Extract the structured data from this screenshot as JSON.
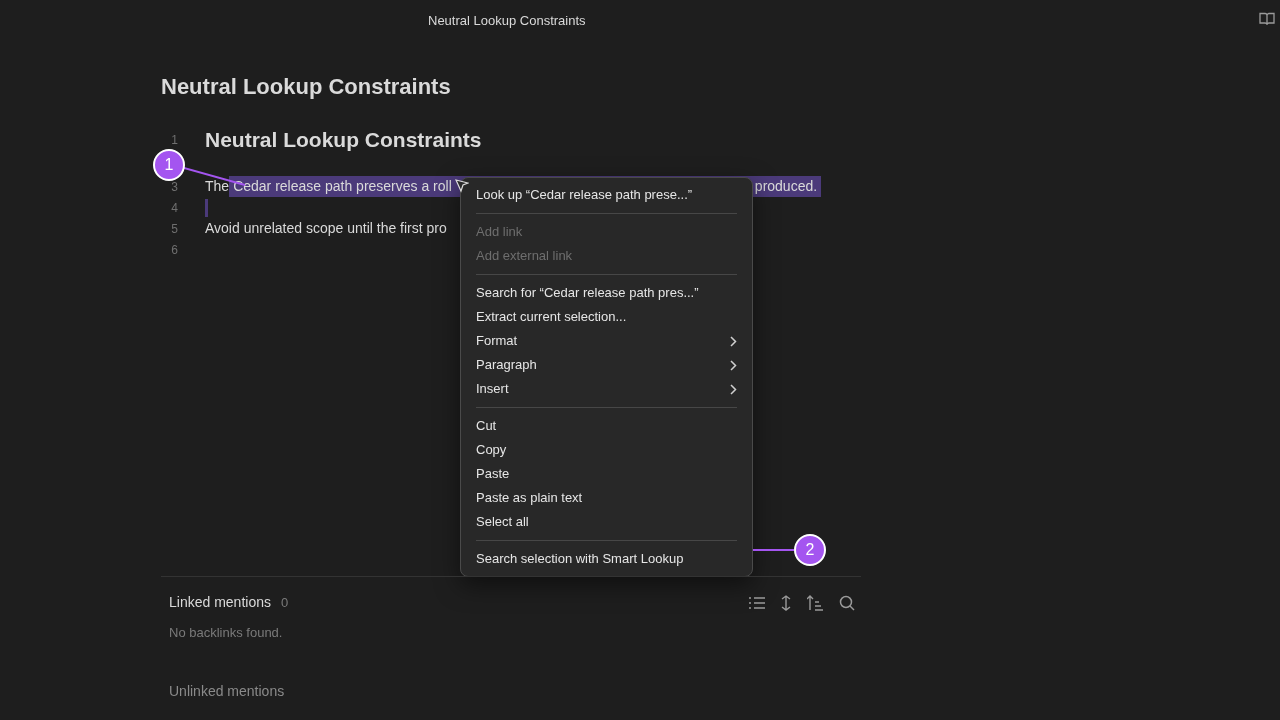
{
  "window": {
    "title": "Neutral Lookup Constraints"
  },
  "note": {
    "title": "Neutral Lookup Constraints",
    "lines": [
      {
        "number": "1",
        "kind": "heading",
        "text": "Neutral Lookup Constraints"
      },
      {
        "kind": "blank"
      },
      {
        "number": "3",
        "kind": "selected",
        "lead": "The ",
        "selected_start": "Cedar release path preserves a roll",
        "selected_end": "produced."
      },
      {
        "number": "4",
        "kind": "caret"
      },
      {
        "number": "5",
        "kind": "text",
        "text": "Avoid unrelated scope until the first pro"
      },
      {
        "number": "6",
        "kind": "blank"
      }
    ]
  },
  "context_menu": {
    "sections": [
      [
        {
          "label": "Look up “Cedar release path prese...”",
          "kind": "item"
        }
      ],
      [
        {
          "label": "Add link",
          "kind": "disabled"
        },
        {
          "label": "Add external link",
          "kind": "disabled"
        }
      ],
      [
        {
          "label": "Search for “Cedar release path pres...”",
          "kind": "item"
        },
        {
          "label": "Extract current selection...",
          "kind": "item"
        },
        {
          "label": "Format",
          "kind": "submenu"
        },
        {
          "label": "Paragraph",
          "kind": "submenu"
        },
        {
          "label": "Insert",
          "kind": "submenu"
        }
      ],
      [
        {
          "label": "Cut",
          "kind": "item"
        },
        {
          "label": "Copy",
          "kind": "item"
        },
        {
          "label": "Paste",
          "kind": "item"
        },
        {
          "label": "Paste as plain text",
          "kind": "item"
        },
        {
          "label": "Select all",
          "kind": "item"
        }
      ],
      [
        {
          "label": "Search selection with Smart Lookup",
          "kind": "item"
        }
      ]
    ]
  },
  "annotations": [
    "1",
    "2"
  ],
  "backlinks": {
    "linked_title": "Linked mentions",
    "linked_count": "0",
    "empty_message": "No backlinks found.",
    "unlinked_title": "Unlinked mentions"
  }
}
